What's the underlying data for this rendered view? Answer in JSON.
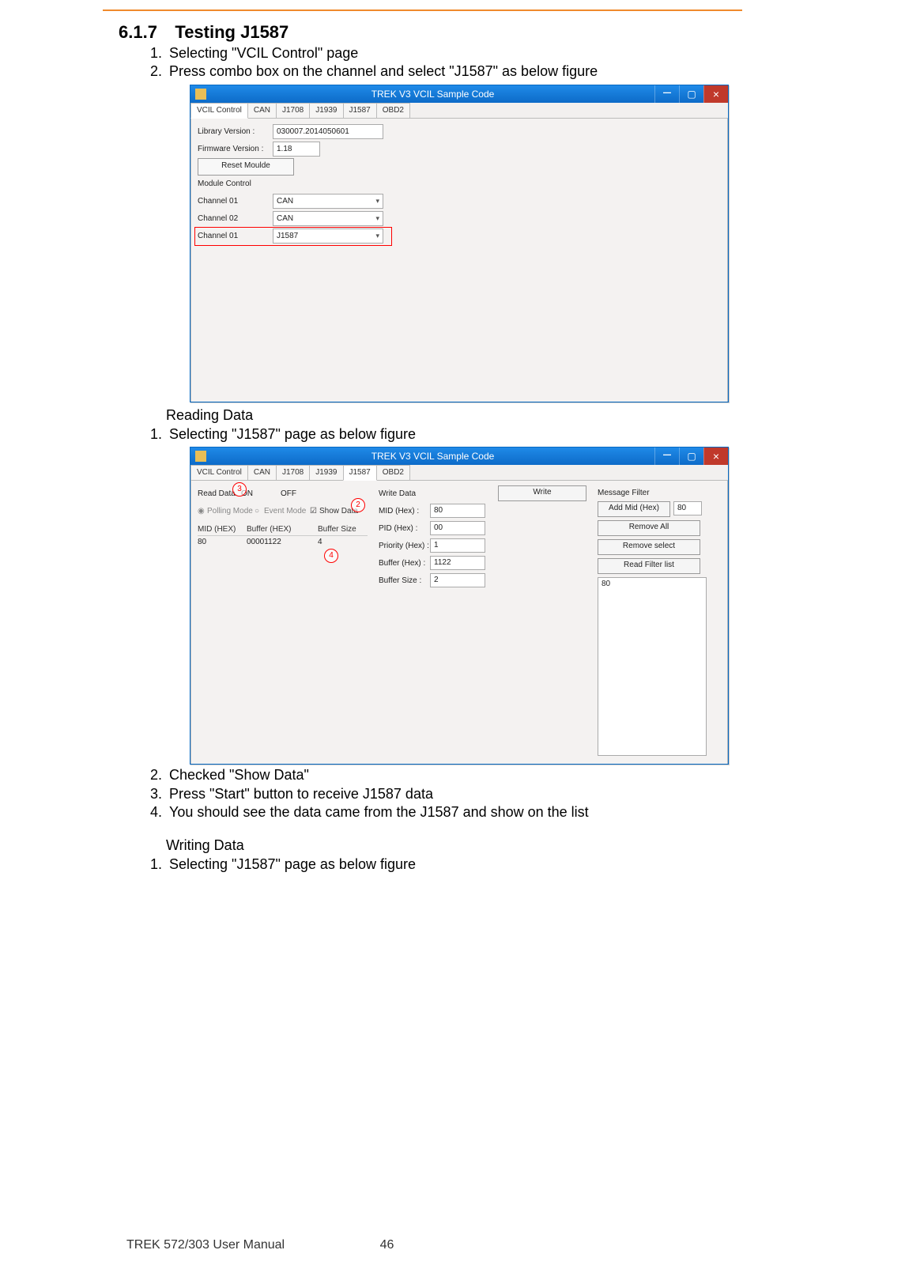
{
  "doc": {
    "section_number": "6.1.7",
    "section_title": "Testing J1587",
    "intro_list": [
      "Selecting \"VCIL Control\" page",
      "Press combo box on the channel and select \"J1587\" as below figure"
    ],
    "reading_header": "Reading Data",
    "reading_list": [
      "Selecting \"J1587\" page as below figure"
    ],
    "reading_list2": [
      "Checked \"Show Data\"",
      "Press \"Start\" button to receive J1587 data",
      "You should see the data came from the J1587 and show on the list"
    ],
    "writing_header": "Writing Data",
    "writing_list": [
      "Selecting \"J1587\" page as below figure"
    ],
    "footer_left": "TREK 572/303 User Manual",
    "footer_page": "46"
  },
  "win1": {
    "title": "TREK V3 VCIL Sample Code",
    "tabs": [
      "VCIL Control",
      "CAN",
      "J1708",
      "J1939",
      "J1587",
      "OBD2"
    ],
    "active_tab": 0,
    "lib_label": "Library Version :",
    "lib_value": "030007.2014050601",
    "fw_label": "Firmware Version :",
    "fw_value": "1.18",
    "reset_btn": "Reset Moulde",
    "module_ctl_label": "Module Control",
    "ch1_label": "Channel 01",
    "ch1_value": "CAN",
    "ch2_label": "Channel 02",
    "ch2_value": "CAN",
    "ch3_label": "Channel 01",
    "ch3_value": "J1587"
  },
  "win2": {
    "title": "TREK V3 VCIL Sample Code",
    "tabs": [
      "VCIL Control",
      "CAN",
      "J1708",
      "J1939",
      "J1587",
      "OBD2"
    ],
    "active_tab": 4,
    "read_lbl": "Read Data",
    "on_lbl": "ON",
    "off_lbl": "OFF",
    "polling_lbl": "Polling Mode",
    "event_lbl": "Event Mode",
    "showdata_lbl": "Show Data",
    "cols": {
      "c1": "MID (HEX)",
      "c2": "Buffer (HEX)",
      "c3": "Buffer Size"
    },
    "row": {
      "c1": "80",
      "c2": "00001122",
      "c3": "4"
    },
    "write_header": "Write Data",
    "write_btn": "Write",
    "mid_lbl": "MID (Hex) :",
    "mid_val": "80",
    "pid_lbl": "PID (Hex) :",
    "pid_val": "00",
    "prio_lbl": "Priority (Hex) :",
    "prio_val": "1",
    "buf_lbl": "Buffer (Hex) :",
    "buf_val": "1122",
    "bsz_lbl": "Buffer Size :",
    "bsz_val": "2",
    "filter_header": "Message Filter",
    "addmid_btn": "Add Mid (Hex)",
    "addmid_val": "80",
    "removeall_btn": "Remove All",
    "removesel_btn": "Remove select",
    "readlist_btn": "Read Filter list",
    "filter_item": "80",
    "callouts": {
      "c2": "2",
      "c3": "3",
      "c4": "4"
    }
  }
}
